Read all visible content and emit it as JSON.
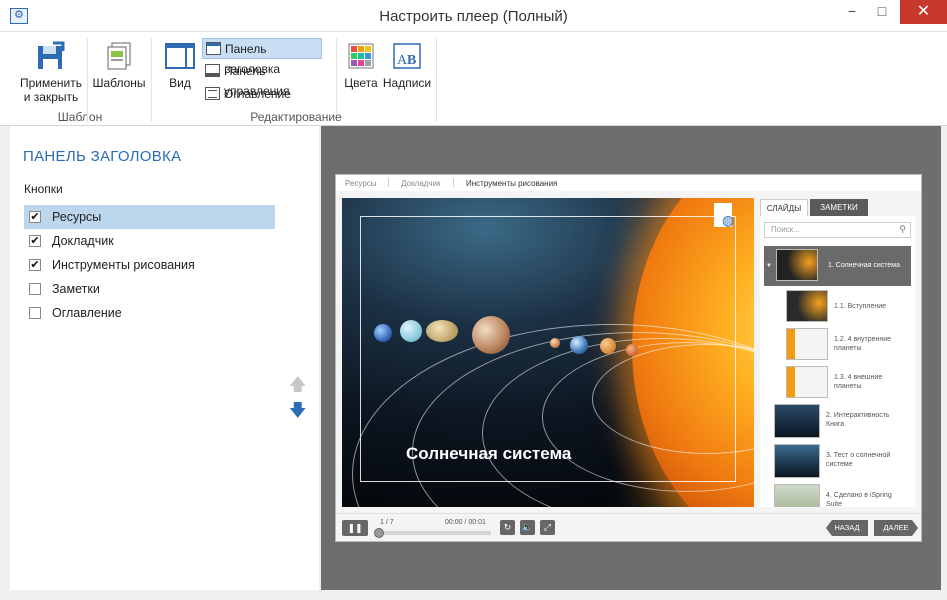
{
  "window": {
    "title": "Настроить плеер (Полный)",
    "minimize": "−",
    "maximize": "□",
    "close": "✕"
  },
  "ribbon": {
    "apply_label_1": "Применить",
    "apply_label_2": "и закрыть",
    "templates_label": "Шаблоны",
    "group_template": "Шаблон",
    "view_label": "Вид",
    "header_panel": "Панель заголовка",
    "control_panel": "Панель управления",
    "toc": "Оглавление",
    "colors_label": "Цвета",
    "captions_label": "Надписи",
    "group_editing": "Редактирование"
  },
  "left_panel": {
    "title": "ПАНЕЛЬ ЗАГОЛОВКА",
    "section": "Кнопки",
    "items": [
      {
        "label": "Ресурсы",
        "checked": true,
        "selected": true
      },
      {
        "label": "Докладчик",
        "checked": true,
        "selected": false
      },
      {
        "label": "Инструменты рисования",
        "checked": true,
        "selected": false
      },
      {
        "label": "Заметки",
        "checked": false,
        "selected": false
      },
      {
        "label": "Оглавление",
        "checked": false,
        "selected": false
      }
    ]
  },
  "player": {
    "tabs": [
      "Ресурсы",
      "Докладчик",
      "Инструменты рисования"
    ],
    "slide_title": "Солнечная система",
    "sidebar_tabs": [
      "СЛАЙДЫ",
      "ЗАМЕТКИ"
    ],
    "search_placeholder": "Поиск...",
    "toc": [
      "1. Солнечная система",
      "1.1. Вступление",
      "1.2. 4 внутренние планеты",
      "1.3. 4 внешние планеты",
      "2. Интерактивность Книга",
      "3. Тест о солнечной системе",
      "4. Сделано в iSpring Suite"
    ],
    "slide_count": "1 / 7",
    "time": "00:00 / 00:01",
    "progress": 0,
    "prev": "НАЗАД",
    "next": "ДАЛЕЕ"
  },
  "colors": {
    "accent": "#2d6bb3",
    "selection": "#bcd6ee",
    "close_red": "#c7382c",
    "preview_bg": "#6e6e6e"
  }
}
